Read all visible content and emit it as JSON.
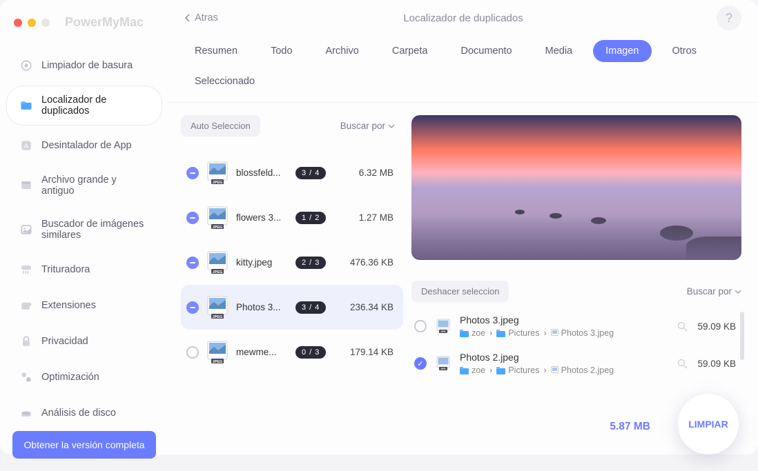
{
  "brand": "PowerMyMac",
  "header": {
    "back": "Atras",
    "title": "Localizador de duplicados",
    "help": "?"
  },
  "sidebar": {
    "items": [
      {
        "label": "Limpiador de basura",
        "icon": "gear-icon"
      },
      {
        "label": "Localizador de duplicados",
        "icon": "folder-icon"
      },
      {
        "label": "Desintalador de App",
        "icon": "app-icon"
      },
      {
        "label": "Archivo grande y antiguo",
        "icon": "archive-icon"
      },
      {
        "label": "Buscador de imágenes similares",
        "icon": "image-icon"
      },
      {
        "label": "Trituradora",
        "icon": "shredder-icon"
      },
      {
        "label": "Extensiones",
        "icon": "puzzle-icon"
      },
      {
        "label": "Privacidad",
        "icon": "lock-icon"
      },
      {
        "label": "Optimización",
        "icon": "optimize-icon"
      },
      {
        "label": "Análisis de disco",
        "icon": "disk-icon"
      }
    ],
    "cta": "Obtener la versión completa"
  },
  "tabs": {
    "items": [
      "Resumen",
      "Todo",
      "Archivo",
      "Carpeta",
      "Documento",
      "Media",
      "Imagen",
      "Otros",
      "Seleccionado"
    ],
    "active": 6
  },
  "list": {
    "auto": "Auto Seleccion",
    "sort": "Buscar por",
    "files": [
      {
        "name": "blossfeld...",
        "badge": "3 / 4",
        "size": "6.32 MB",
        "check": "partial"
      },
      {
        "name": "flowers 3...",
        "badge": "1 / 2",
        "size": "1.27 MB",
        "check": "partial"
      },
      {
        "name": "kitty.jpeg",
        "badge": "2 / 3",
        "size": "476.36 KB",
        "check": "partial"
      },
      {
        "name": "Photos 3...",
        "badge": "3 / 4",
        "size": "236.34 KB",
        "check": "partial",
        "selected": true
      },
      {
        "name": "mewme...",
        "badge": "0 / 3",
        "size": "179.14 KB",
        "check": "none"
      }
    ]
  },
  "dup": {
    "undo": "Deshacer seleccion",
    "sort": "Buscar por",
    "items": [
      {
        "name": "Photos 3.jpeg",
        "path": [
          "zoe",
          "Pictures",
          "Photos 3.jpeg"
        ],
        "size": "59.09 KB",
        "check": "none"
      },
      {
        "name": "Photos 2.jpeg",
        "path": [
          "zoe",
          "Pictures",
          "Photos 2.jpeg"
        ],
        "size": "59.09 KB",
        "check": "checked"
      }
    ]
  },
  "footer": {
    "total": "5.87 MB",
    "clean": "LIMPIAR"
  },
  "colors": {
    "accent": "#6a7cff"
  }
}
